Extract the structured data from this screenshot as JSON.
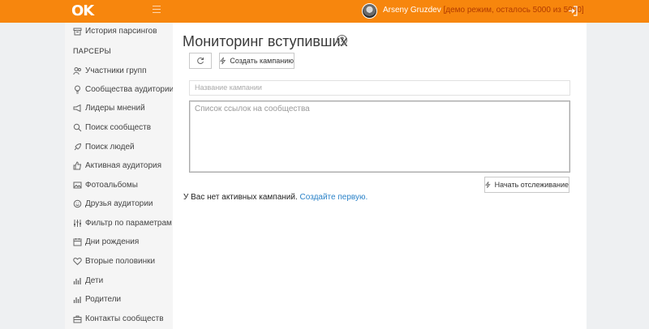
{
  "topbar": {
    "logo": "OK",
    "username": "Arseny Gruzdev",
    "demo_text": "[демо режим, осталось 5000 из 5000]"
  },
  "sidebar": {
    "history_label": "История парсингов",
    "section_title": "ПАРСЕРЫ",
    "items": [
      {
        "label": "Участники групп",
        "icon": "users-icon"
      },
      {
        "label": "Сообщества аудитории",
        "icon": "lightbulb-icon"
      },
      {
        "label": "Лидеры мнений",
        "icon": "megaphone-icon"
      },
      {
        "label": "Поиск сообществ",
        "icon": "search-icon"
      },
      {
        "label": "Поиск людей",
        "icon": "rocket-icon"
      },
      {
        "label": "Активная аудитория",
        "icon": "thumbs-up-icon"
      },
      {
        "label": "Фотоальбомы",
        "icon": "image-icon"
      },
      {
        "label": "Друзья аудитории",
        "icon": "smile-icon"
      },
      {
        "label": "Фильтр по параметрам",
        "icon": "sliders-icon"
      },
      {
        "label": "Дни рождения",
        "icon": "calendar-icon"
      },
      {
        "label": "Вторые половинки",
        "icon": "heart-icon"
      },
      {
        "label": "Дети",
        "icon": "bars-icon"
      },
      {
        "label": "Родители",
        "icon": "bars-icon"
      },
      {
        "label": "Контакты сообществ",
        "icon": "briefcase-icon"
      }
    ]
  },
  "main": {
    "title": "Мониторинг вступивших",
    "help": "?",
    "create_campaign_label": "Создать кампанию",
    "campaign_name_placeholder": "Название кампании",
    "links_placeholder": "Список ссылок на сообщества",
    "start_tracking_label": "Начать отслеживание",
    "empty_text": "У Вас нет активных кампаний.",
    "empty_link": "Создайте первую."
  },
  "colors": {
    "topbar": "#f7860d",
    "link": "#2a82c8"
  }
}
